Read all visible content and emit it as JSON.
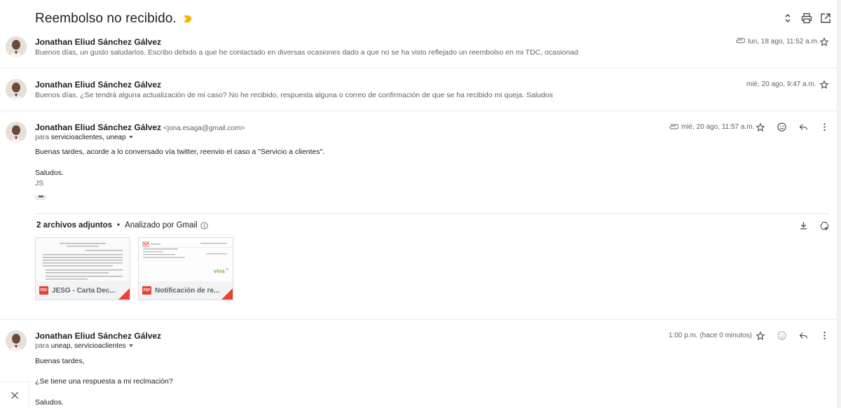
{
  "thread": {
    "subject": "Reembolso no recibido.",
    "accent": "#f4b400"
  },
  "messages": [
    {
      "sender": "Jonathan Eliud Sánchez Gálvez",
      "snippet": "Buenos días, un gusto saludarlos. Escribo debido a que he contactado en diversas ocasiones dado a que no se ha visto reflejado un reembolso en mi TDC, ocasionad",
      "date": "lun, 18 ago, 11:52 a.m."
    },
    {
      "sender": "Jonathan Eliud Sánchez Gálvez",
      "snippet": "Buenos días. ¿Se tendrá alguna actualización de mi caso? No he recibido, respuesta alguna o correo de confirmación de que se ha recibido mi queja. Saludos",
      "date": "mié, 20 ago, 9:47 a.m."
    },
    {
      "sender": "Jonathan Eliud Sánchez Gálvez",
      "email": "<jona.esaga@gmail.com>",
      "recipients_prefix": "para ",
      "recipients": "servicioaclientes, uneap",
      "date": "mié, 20 ago, 11:57 a.m.",
      "body": [
        "Buenas tardes, acorde a lo conversado vía twitter, reenvio el caso a \"Servicio a clientes\".",
        "Saludos.",
        "JS"
      ],
      "ellipsis": "•••",
      "attachments_title": "2 archivos adjuntos",
      "scanned_label": "Analizado por Gmail",
      "attachments": [
        {
          "name": "JESG - Carta Dec...",
          "badge": "PDF"
        },
        {
          "name": "Notificación de re...",
          "badge": "PDF"
        }
      ]
    },
    {
      "sender": "Jonathan Eliud Sánchez Gálvez",
      "recipients_prefix": "para ",
      "recipients": "uneap, servicioaclientes",
      "date": "1:00 p.m. (hace 0 minutos)",
      "body": [
        "Buenas tardes,",
        "¿Se tiene una respuesta a mi reclmación?",
        "Saludos."
      ]
    }
  ],
  "icons": {
    "expand": "unfold-icon",
    "print": "print-icon",
    "popout": "open-new-window-icon",
    "star": "star-icon",
    "emoji": "emoji-icon",
    "reply": "reply-icon",
    "more": "more-vert-icon",
    "download": "download-icon",
    "drive": "add-to-drive-icon",
    "attachment": "paperclip-icon",
    "close": "close-icon"
  },
  "colors": {
    "pdf_red": "#ea4335",
    "text": "#202124",
    "muted": "#5f6368"
  }
}
